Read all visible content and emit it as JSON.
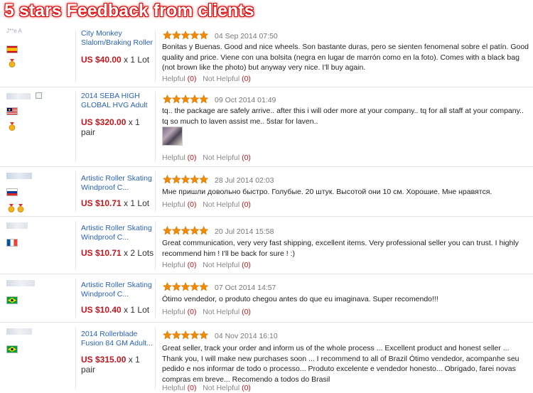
{
  "banner": {
    "title": "5 stars Feedback from clients"
  },
  "labels": {
    "helpful": "Helpful",
    "not_helpful": "Not Helpful"
  },
  "reviews": [
    {
      "username": "J**e A",
      "country": "spain",
      "product": [
        "City Monkey",
        "Slalom/Braking Roller"
      ],
      "price": "US $40.00",
      "quantity": "x 1 Lot",
      "rating": 5,
      "date": "04 Sep 2014 07:50",
      "comment": "Bonitas y Buenas. Good and nice wheels. Son bastante duras, pero se sienten fenomenal sobre el patín. Good quality and price. Viene con una bolsita (negra en lugar de marrón como en la foto). Comes with a black bag (not brown like the photo) but anyway very nice. I'll buy again.",
      "helpful_count": "(0)",
      "not_helpful_count": "(0)"
    },
    {
      "username": "",
      "country": "malaysia",
      "product": [
        "2014 SEBA HIGH",
        "GLOBAL HVG Adult"
      ],
      "price": "US $320.00",
      "quantity": "x 1",
      "quantity2": "pair",
      "rating": 5,
      "date": "09 Oct 2014 01:49",
      "comment": "tq.. the package are safely arrive.. after this i will oder more at your company.. tq for all staff at your company.. tq so much to laven assist me.. 5star for laven..",
      "helpful_count": "(0)",
      "not_helpful_count": "(0)"
    },
    {
      "username": "",
      "country": "russia",
      "product": [
        "Artistic Roller Skating",
        "Windproof C..."
      ],
      "price": "US $10.71",
      "quantity": "x 1 Lot",
      "rating": 5,
      "date": "28 Jul 2014 02:03",
      "comment": "Мне пришли довольно быстро. Голубые. 20 штук. Высотой они 10 см. Хорошие. Мне нравятся.",
      "helpful_count": "(0)",
      "not_helpful_count": "(0)"
    },
    {
      "username": "",
      "country": "france",
      "product": [
        "Artistic Roller Skating",
        "Windproof C..."
      ],
      "price": "US $10.71",
      "quantity": "x 2 Lots",
      "rating": 5,
      "date": "20 Jul 2014 15:58",
      "comment": "Great communication, very very fast shipping, excellent items. Very professional seller you can trust. I highly recommend him ! I'll be back for sure ! :)",
      "helpful_count": "(0)",
      "not_helpful_count": "(0)"
    },
    {
      "username": "",
      "country": "brazil",
      "product": [
        "Artistic Roller Skating",
        "Windproof C..."
      ],
      "price": "US $10.40",
      "quantity": "x 1 Lot",
      "rating": 5,
      "date": "07 Oct 2014 14:57",
      "comment": "Ótimo vendedor, o produto chegou antes do que eu imaginava. Super recomendo!!!",
      "helpful_count": "(0)",
      "not_helpful_count": "(0)"
    },
    {
      "username": "",
      "country": "brazil",
      "product": [
        "2014 Rollerblade",
        "Fusion 84 GM Adult..."
      ],
      "price": "US $315.00",
      "quantity": "x 1",
      "quantity2": "pair",
      "rating": 5,
      "date": "04 Nov 2014 16:10",
      "comment": "Great seller, track your order and inform us of the whole process ... Excellent product and honest seller ... Thank you, I will make new purchases soon ... I recommend to all of Brazil Ótimo vendedor, acompanhe seu pedido e nos informar de todo o processo... Produto excelente e vendedor honesto... Obrigado, farei novas compras em breve... Recomendo a todos do Brasil",
      "helpful_count": "(0)",
      "not_helpful_count": "(0)"
    }
  ],
  "colors": {
    "accent": "#c4161c",
    "link": "#2a62b8",
    "star": "#f08a00",
    "banner_glow": "#e01010"
  }
}
